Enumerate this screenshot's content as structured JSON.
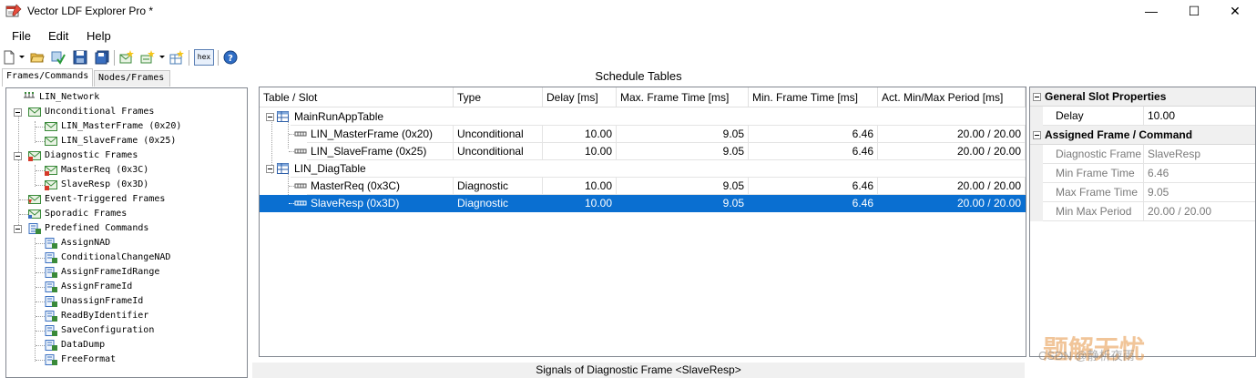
{
  "window": {
    "title": "Vector LDF Explorer Pro *",
    "minimize": "—",
    "maximize": "☐",
    "close": "✕"
  },
  "menu": {
    "file": "File",
    "edit": "Edit",
    "help": "Help"
  },
  "toolbar": {
    "hex_label": "hex"
  },
  "tabs": {
    "frames_commands": "Frames/Commands",
    "nodes_frames": "Nodes/Frames"
  },
  "tree": {
    "root": "LIN_Network",
    "unconditional": "Unconditional Frames",
    "master_frame": "LIN_MasterFrame (0x20)",
    "slave_frame": "LIN_SlaveFrame (0x25)",
    "diagnostic": "Diagnostic Frames",
    "master_req": "MasterReq (0x3C)",
    "slave_resp": "SlaveResp (0x3D)",
    "event_triggered": "Event-Triggered Frames",
    "sporadic": "Sporadic Frames",
    "predefined": "Predefined Commands",
    "commands": [
      "AssignNAD",
      "ConditionalChangeNAD",
      "AssignFrameIdRange",
      "AssignFrameId",
      "UnassignFrameId",
      "ReadByIdentifier",
      "SaveConfiguration",
      "DataDump",
      "FreeFormat"
    ]
  },
  "schedule": {
    "header": "Schedule Tables",
    "columns": {
      "slot": "Table / Slot",
      "type": "Type",
      "delay": "Delay [ms]",
      "max_frame": "Max. Frame Time [ms]",
      "min_frame": "Min. Frame Time [ms]",
      "period": "Act. Min/Max Period [ms]"
    },
    "tables": [
      {
        "name": "MainRunAppTable",
        "slots": [
          {
            "name": "LIN_MasterFrame (0x20)",
            "type": "Unconditional",
            "delay": "10.00",
            "max": "9.05",
            "min": "6.46",
            "period": "20.00 / 20.00"
          },
          {
            "name": "LIN_SlaveFrame (0x25)",
            "type": "Unconditional",
            "delay": "10.00",
            "max": "9.05",
            "min": "6.46",
            "period": "20.00 / 20.00"
          }
        ]
      },
      {
        "name": "LIN_DiagTable",
        "slots": [
          {
            "name": "MasterReq (0x3C)",
            "type": "Diagnostic",
            "delay": "10.00",
            "max": "9.05",
            "min": "6.46",
            "period": "20.00 / 20.00"
          },
          {
            "name": "SlaveResp (0x3D)",
            "type": "Diagnostic",
            "delay": "10.00",
            "max": "9.05",
            "min": "6.46",
            "period": "20.00 / 20.00"
          }
        ]
      }
    ]
  },
  "properties": {
    "group1": "General Slot Properties",
    "delay_key": "Delay",
    "delay_val": "10.00",
    "group2": "Assigned Frame / Command",
    "diag_key": "Diagnostic Frame",
    "diag_val": "SlaveResp",
    "minft_key": "Min Frame Time",
    "minft_val": "6.46",
    "maxft_key": "Max Frame Time",
    "maxft_val": "9.05",
    "period_key": "Min Max Period",
    "period_val": "20.00 / 20.00"
  },
  "signals_header": "Signals of Diagnostic Frame <SlaveResp>",
  "watermark": "题解无忧",
  "watermark_sub": "CSDN @静析夜雨",
  "colors": {
    "selection": "#0a6fd1",
    "accent_blue": "#1e5fb4",
    "frame_green": "#3a9a4a"
  }
}
